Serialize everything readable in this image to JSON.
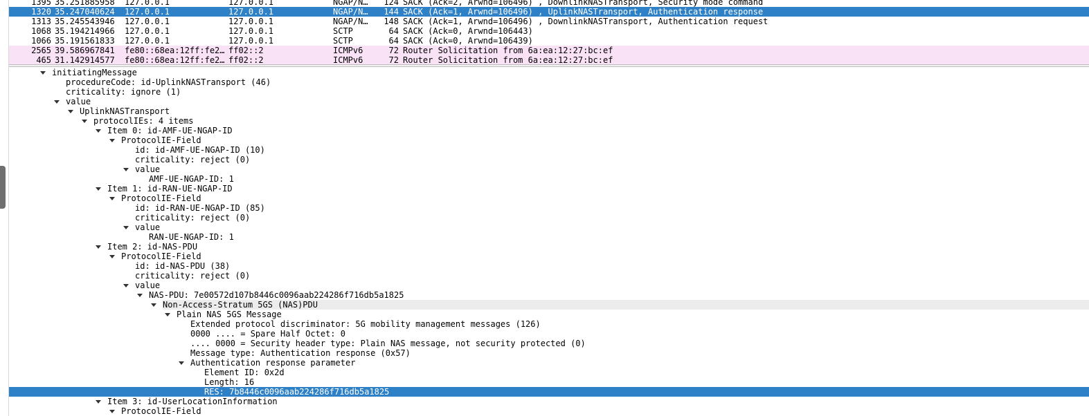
{
  "packet_list": {
    "rows": [
      {
        "no": "1395",
        "time": "35.251885958",
        "src": "127.0.0.1",
        "dst": "127.0.0.1",
        "proto": "NGAP/N…",
        "len": "124",
        "info": "SACK (Ack=2, Arwnd=106496) , DownlinkNASTransport, Security mode command",
        "style": "plain"
      },
      {
        "no": "1320",
        "time": "35.247040624",
        "src": "127.0.0.1",
        "dst": "127.0.0.1",
        "proto": "NGAP/N…",
        "len": "144",
        "info": "SACK (Ack=1, Arwnd=106496) , UplinkNASTransport, Authentication response",
        "style": "selected"
      },
      {
        "no": "1313",
        "time": "35.245543946",
        "src": "127.0.0.1",
        "dst": "127.0.0.1",
        "proto": "NGAP/N…",
        "len": "148",
        "info": "SACK (Ack=1, Arwnd=106496) , DownlinkNASTransport, Authentication request",
        "style": "plain"
      },
      {
        "no": "1068",
        "time": "35.194214966",
        "src": "127.0.0.1",
        "dst": "127.0.0.1",
        "proto": "SCTP",
        "len": "64",
        "info": "SACK (Ack=0, Arwnd=106443)",
        "style": "plain"
      },
      {
        "no": "1066",
        "time": "35.191561833",
        "src": "127.0.0.1",
        "dst": "127.0.0.1",
        "proto": "SCTP",
        "len": "64",
        "info": "SACK (Ack=0, Arwnd=106439)",
        "style": "plain"
      },
      {
        "no": "2565",
        "time": "39.586967841",
        "src": "fe80::68ea:12ff:fe2…",
        "dst": "ff02::2",
        "proto": "ICMPv6",
        "len": "72",
        "info": "Router Solicitation from 6a:ea:12:27:bc:ef",
        "style": "pink"
      },
      {
        "no": "465",
        "time": "31.142914577",
        "src": "fe80::68ea:12ff:fe2…",
        "dst": "ff02::2",
        "proto": "ICMPv6",
        "len": "72",
        "info": "Router Solicitation from 6a:ea:12:27:bc:ef",
        "style": "pink"
      }
    ]
  },
  "details": {
    "rows": [
      {
        "depth": 0,
        "expanded": true,
        "text": "initiatingMessage"
      },
      {
        "depth": 1,
        "expanded": false,
        "text": "procedureCode: id-UplinkNASTransport (46)"
      },
      {
        "depth": 1,
        "expanded": false,
        "text": "criticality: ignore (1)"
      },
      {
        "depth": 1,
        "expanded": true,
        "text": "value"
      },
      {
        "depth": 2,
        "expanded": true,
        "text": "UplinkNASTransport"
      },
      {
        "depth": 3,
        "expanded": true,
        "text": "protocolIEs: 4 items"
      },
      {
        "depth": 4,
        "expanded": true,
        "text": "Item 0: id-AMF-UE-NGAP-ID"
      },
      {
        "depth": 5,
        "expanded": true,
        "text": "ProtocolIE-Field"
      },
      {
        "depth": 6,
        "expanded": false,
        "text": "id: id-AMF-UE-NGAP-ID (10)"
      },
      {
        "depth": 6,
        "expanded": false,
        "text": "criticality: reject (0)"
      },
      {
        "depth": 6,
        "expanded": true,
        "text": "value"
      },
      {
        "depth": 7,
        "expanded": false,
        "text": "AMF-UE-NGAP-ID: 1"
      },
      {
        "depth": 4,
        "expanded": true,
        "text": "Item 1: id-RAN-UE-NGAP-ID"
      },
      {
        "depth": 5,
        "expanded": true,
        "text": "ProtocolIE-Field"
      },
      {
        "depth": 6,
        "expanded": false,
        "text": "id: id-RAN-UE-NGAP-ID (85)"
      },
      {
        "depth": 6,
        "expanded": false,
        "text": "criticality: reject (0)"
      },
      {
        "depth": 6,
        "expanded": true,
        "text": "value"
      },
      {
        "depth": 7,
        "expanded": false,
        "text": "RAN-UE-NGAP-ID: 1"
      },
      {
        "depth": 4,
        "expanded": true,
        "text": "Item 2: id-NAS-PDU"
      },
      {
        "depth": 5,
        "expanded": true,
        "text": "ProtocolIE-Field"
      },
      {
        "depth": 6,
        "expanded": false,
        "text": "id: id-NAS-PDU (38)"
      },
      {
        "depth": 6,
        "expanded": false,
        "text": "criticality: reject (0)"
      },
      {
        "depth": 6,
        "expanded": true,
        "text": "value"
      },
      {
        "depth": 7,
        "expanded": true,
        "text": "NAS-PDU: 7e00572d107b8446c0096aab224286f716db5a1825"
      },
      {
        "depth": 8,
        "expanded": true,
        "text": "Non-Access-Stratum 5GS (NAS)PDU",
        "style": "highlight"
      },
      {
        "depth": 9,
        "expanded": true,
        "text": "Plain NAS 5GS Message"
      },
      {
        "depth": 10,
        "expanded": false,
        "text": "Extended protocol discriminator: 5G mobility management messages (126)"
      },
      {
        "depth": 10,
        "expanded": false,
        "text": "0000 .... = Spare Half Octet: 0"
      },
      {
        "depth": 10,
        "expanded": false,
        "text": ".... 0000 = Security header type: Plain NAS message, not security protected (0)"
      },
      {
        "depth": 10,
        "expanded": false,
        "text": "Message type: Authentication response (0x57)"
      },
      {
        "depth": 10,
        "expanded": true,
        "text": "Authentication response parameter"
      },
      {
        "depth": 11,
        "expanded": false,
        "text": "Element ID: 0x2d"
      },
      {
        "depth": 11,
        "expanded": false,
        "text": "Length: 16"
      },
      {
        "depth": 11,
        "expanded": false,
        "text": "RES: 7b8446c0096aab224286f716db5a1825",
        "style": "selected"
      },
      {
        "depth": 4,
        "expanded": true,
        "text": "Item 3: id-UserLocationInformation"
      },
      {
        "depth": 5,
        "expanded": true,
        "text": "ProtocolIE-Field"
      }
    ]
  },
  "colors": {
    "selection": "#2f81c7",
    "icmpv6_row": "#f9e1f6",
    "hover_row": "#ececec"
  }
}
